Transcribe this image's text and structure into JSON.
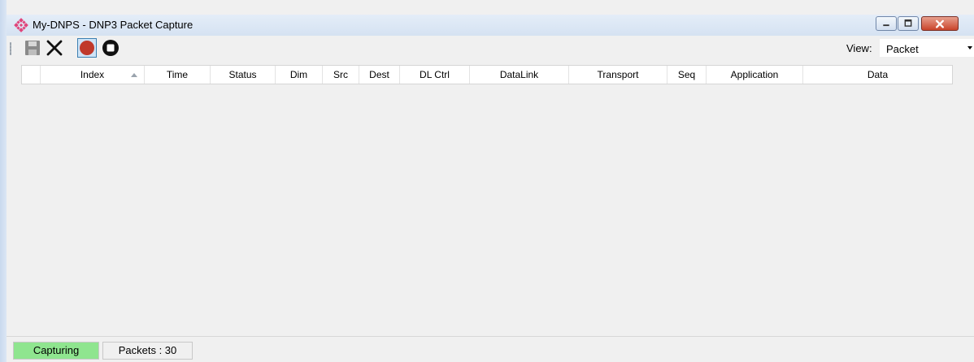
{
  "window": {
    "title": "My-DNPS - DNP3 Packet Capture"
  },
  "toolbar": {
    "buttons": [
      {
        "name": "save",
        "icon": "floppy-disk-icon"
      },
      {
        "name": "clear",
        "icon": "x-icon"
      },
      {
        "name": "record",
        "icon": "record-icon",
        "active": true
      },
      {
        "name": "stop",
        "icon": "stop-icon"
      }
    ],
    "view_label": "View:",
    "view_value": "Packet"
  },
  "table": {
    "columns": [
      "",
      "Index",
      "Time",
      "Status",
      "Dim",
      "Src",
      "Dest",
      "DL Ctrl",
      "DataLink",
      "Transport",
      "Seq",
      "Application",
      "Data"
    ],
    "sorted_column": "Index",
    "rows": []
  },
  "statusbar": {
    "capture_state": "Capturing",
    "packets": "Packets : 30"
  },
  "colors": {
    "capturing_bg": "#8fe58f",
    "record_red": "#c0392b",
    "title_icon": "#e0457b",
    "close_button": "#c9442b"
  }
}
